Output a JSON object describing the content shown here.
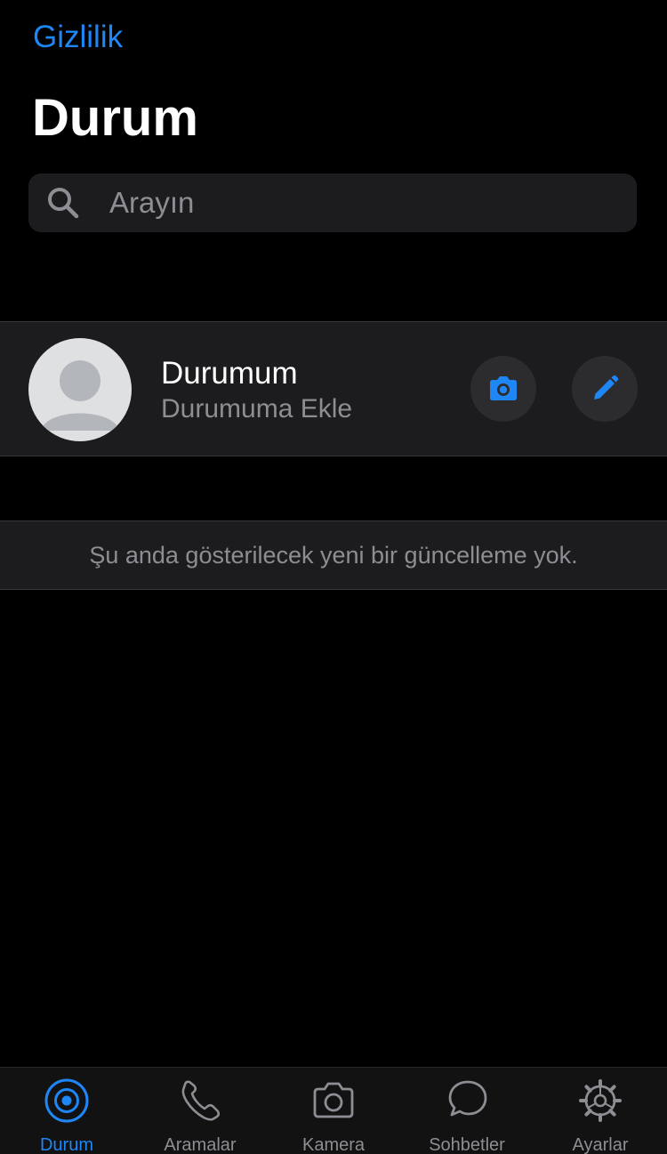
{
  "header": {
    "privacy_link": "Gizlilik",
    "title": "Durum"
  },
  "search": {
    "placeholder": "Arayın",
    "value": ""
  },
  "my_status": {
    "name": "Durumum",
    "subtitle": "Durumuma Ekle",
    "camera_icon": "camera-icon",
    "edit_icon": "pencil-icon"
  },
  "notice": {
    "text": "Şu anda gösterilecek yeni bir güncelleme yok."
  },
  "tab_bar": {
    "active": "Durum",
    "tabs": [
      {
        "label": "Durum",
        "icon": "status-icon"
      },
      {
        "label": "Aramalar",
        "icon": "phone-icon"
      },
      {
        "label": "Kamera",
        "icon": "camera-icon"
      },
      {
        "label": "Sohbetler",
        "icon": "chat-icon"
      },
      {
        "label": "Ayarlar",
        "icon": "gear-icon"
      }
    ]
  },
  "colors": {
    "accent": "#1f86f5",
    "background": "#000000",
    "cell": "#1c1c1e",
    "secondary_text": "#8d8d93"
  }
}
